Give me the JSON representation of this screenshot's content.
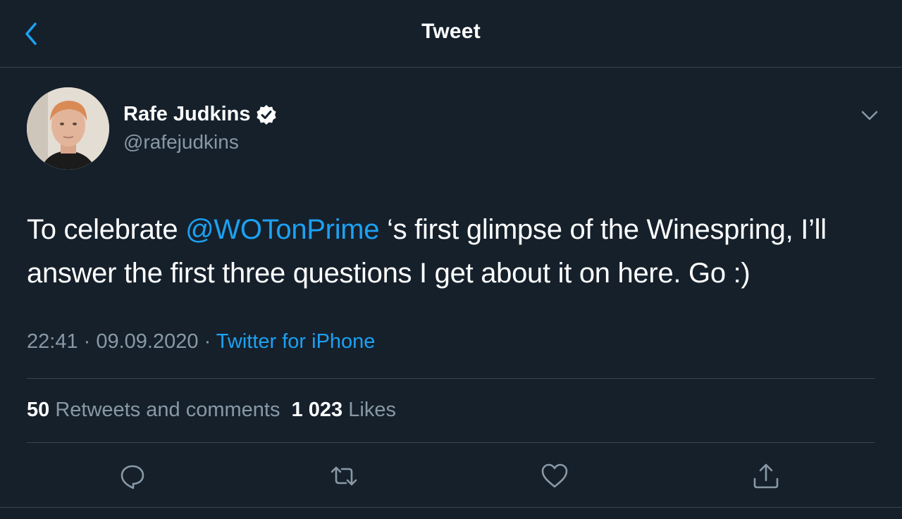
{
  "header": {
    "title": "Tweet",
    "back_icon": "chevron-left-icon"
  },
  "author": {
    "name": "Rafe Judkins",
    "handle": "@rafejudkins",
    "verified_icon": "verified-badge-icon",
    "avatar": "profile-photo"
  },
  "tweet": {
    "text_before": "To celebrate ",
    "mention": "@WOTonPrime",
    "text_after": " ‘s first glimpse of the Winespring, I’ll answer the first three questions I get about it on here.  Go :)"
  },
  "meta": {
    "time": "22:41",
    "separator1": " · ",
    "date": "09.09.2020",
    "separator2": " · ",
    "source": "Twitter for iPhone"
  },
  "stats": {
    "retweets_count": "50",
    "retweets_label": "Retweets and comments",
    "likes_count": "1 023",
    "likes_label": "Likes"
  },
  "actions": {
    "reply_icon": "reply-icon",
    "retweet_icon": "retweet-icon",
    "like_icon": "heart-icon",
    "share_icon": "share-icon"
  },
  "colors": {
    "background": "#15202b",
    "accent": "#1da1f2",
    "secondary_text": "#8899a6",
    "divider": "#38444d"
  }
}
